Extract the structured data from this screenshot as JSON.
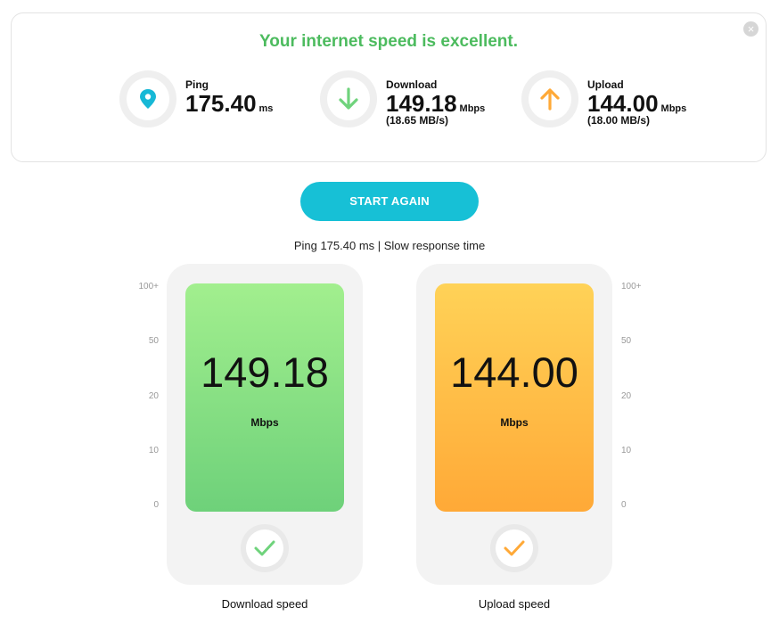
{
  "summary": {
    "headline": "Your internet speed is excellent.",
    "headline_color": "#4cbb5e",
    "close_label": "×",
    "ping": {
      "label": "Ping",
      "value": "175.40",
      "unit": "ms",
      "icon": "location-pin-icon",
      "color": "#17b8d6"
    },
    "download": {
      "label": "Download",
      "value": "149.18",
      "unit": "Mbps",
      "sub": "(18.65 MB/s)",
      "icon": "arrow-down-icon",
      "color": "#6fd37c"
    },
    "upload": {
      "label": "Upload",
      "value": "144.00",
      "unit": "Mbps",
      "sub": "(18.00 MB/s)",
      "icon": "arrow-up-icon",
      "color": "#ffa937"
    }
  },
  "start_button": {
    "label": "START AGAIN",
    "color": "#17c0d6"
  },
  "status_line": "Ping 175.40 ms | Slow response time",
  "scale_ticks": [
    "100+",
    "50",
    "20",
    "10",
    "0"
  ],
  "panels": {
    "download": {
      "value": "149.18",
      "unit": "Mbps",
      "caption": "Download speed",
      "check_color": "#6fd37c"
    },
    "upload": {
      "value": "144.00",
      "unit": "Mbps",
      "caption": "Upload speed",
      "check_color": "#ffa937"
    }
  }
}
